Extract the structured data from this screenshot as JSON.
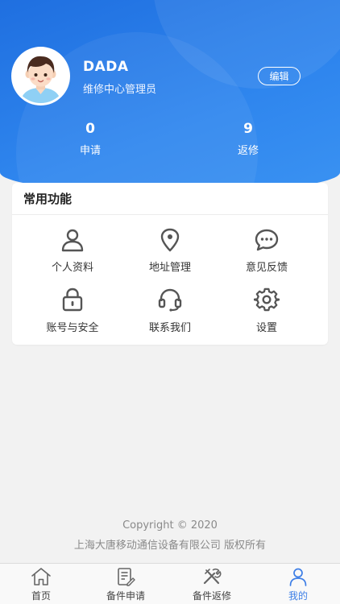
{
  "profile": {
    "name": "DADA",
    "role": "维修中心管理员",
    "edit_label": "编辑"
  },
  "stats": [
    {
      "value": "0",
      "label": "申请"
    },
    {
      "value": "9",
      "label": "返修"
    }
  ],
  "functions": {
    "title": "常用功能",
    "items": [
      {
        "label": "个人资料",
        "icon": "user-icon"
      },
      {
        "label": "地址管理",
        "icon": "location-pin-icon"
      },
      {
        "label": "意见反馈",
        "icon": "chat-bubble-icon"
      },
      {
        "label": "账号与安全",
        "icon": "lock-icon"
      },
      {
        "label": "联系我们",
        "icon": "headset-icon"
      },
      {
        "label": "设置",
        "icon": "gear-icon"
      }
    ]
  },
  "footer": {
    "copyright": "Copyright © 2020",
    "company": "上海大唐移动通信设备有限公司 版权所有"
  },
  "tabbar": {
    "items": [
      {
        "label": "首页",
        "icon": "home-icon"
      },
      {
        "label": "备件申请",
        "icon": "form-document-icon"
      },
      {
        "label": "备件返修",
        "icon": "repair-tools-icon"
      },
      {
        "label": "我的",
        "icon": "user-icon"
      }
    ],
    "active_color": "#3d7ee6"
  },
  "colors": {
    "header_blue": "#2a7de8",
    "background": "#f2f2f2"
  }
}
